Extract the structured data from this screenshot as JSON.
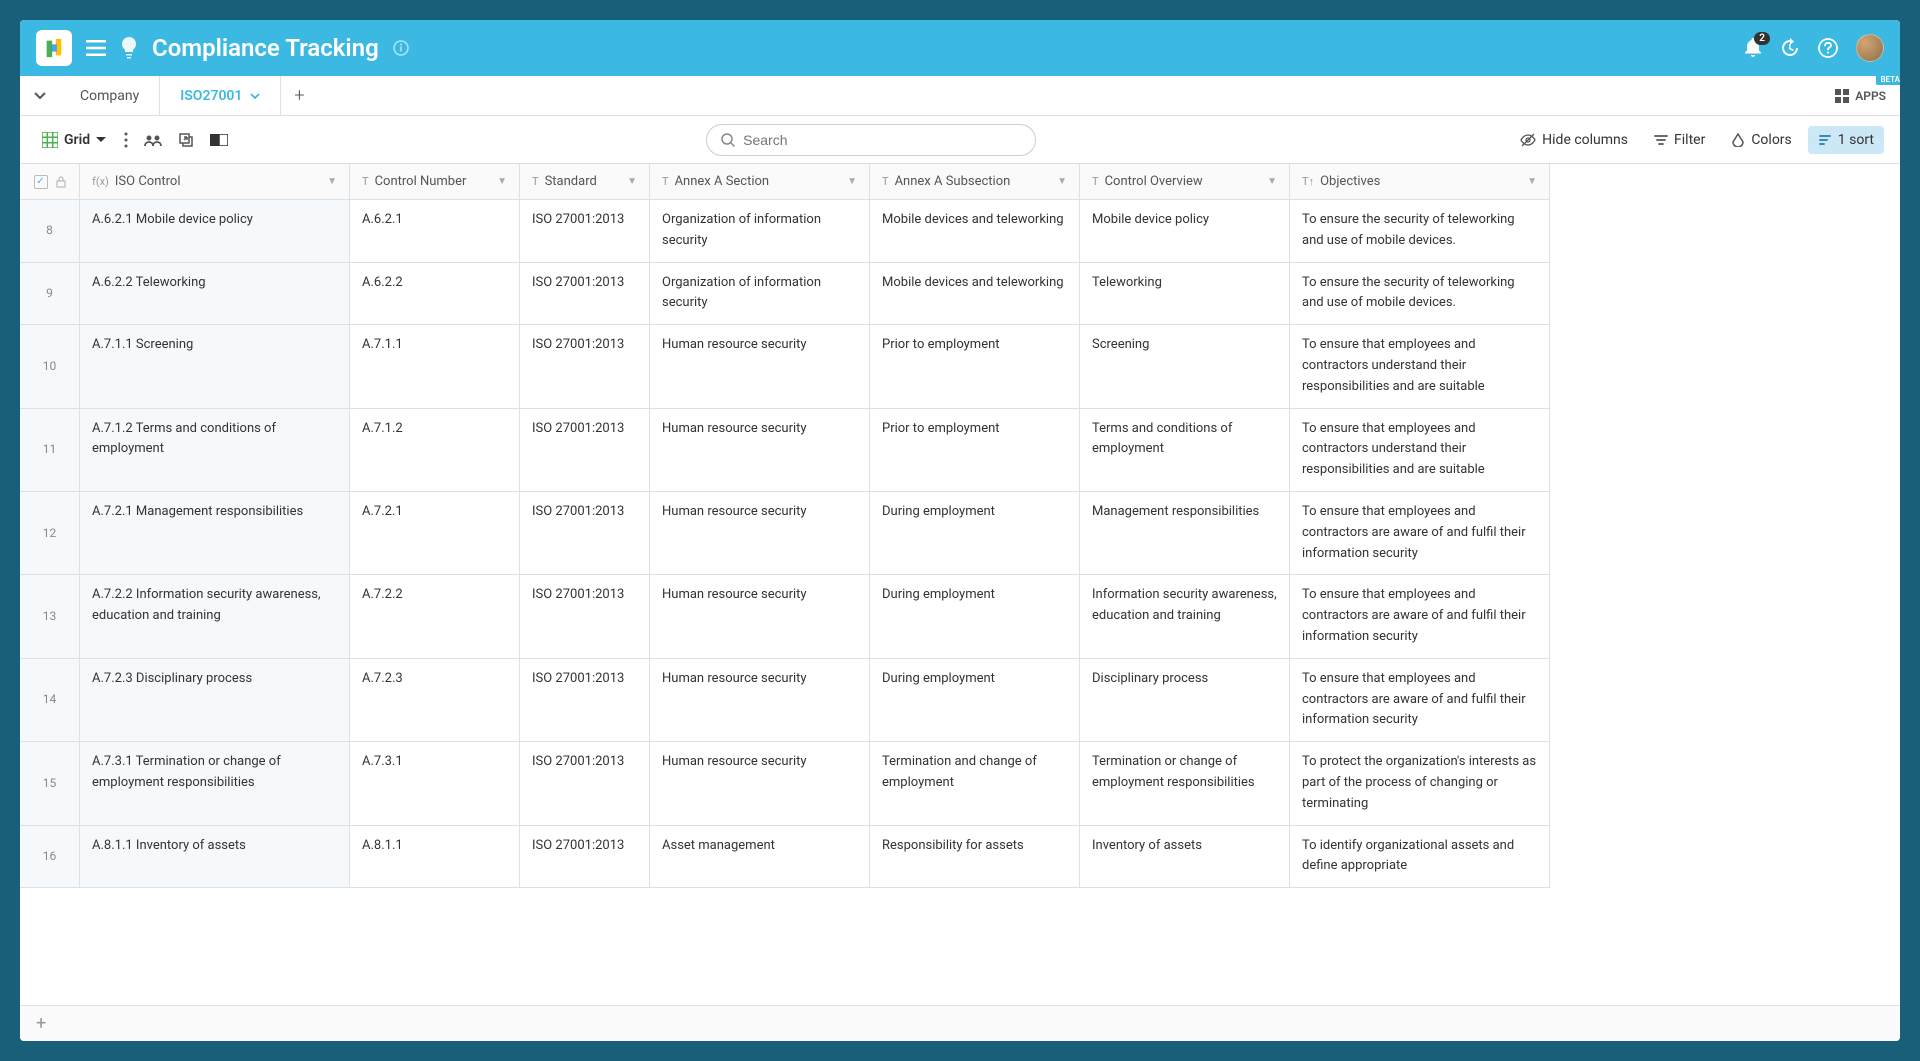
{
  "header": {
    "title": "Compliance Tracking",
    "notification_count": "2"
  },
  "tabs": {
    "items": [
      {
        "label": "Company",
        "active": false
      },
      {
        "label": "ISO27001",
        "active": true
      }
    ],
    "apps_label": "APPS",
    "beta_label": "BETA"
  },
  "toolbar": {
    "view_label": "Grid",
    "search_placeholder": "Search",
    "hide_columns": "Hide columns",
    "filter": "Filter",
    "colors": "Colors",
    "sort": "1 sort"
  },
  "columns": [
    {
      "label": "ISO Control",
      "type": "f(x)"
    },
    {
      "label": "Control Number",
      "type": "T"
    },
    {
      "label": "Standard",
      "type": "T"
    },
    {
      "label": "Annex A Section",
      "type": "T"
    },
    {
      "label": "Annex A Subsection",
      "type": "T"
    },
    {
      "label": "Control Overview",
      "type": "T"
    },
    {
      "label": "Objectives",
      "type": "T↑"
    }
  ],
  "rows": [
    {
      "n": "8",
      "iso": "A.6.2.1 Mobile device policy",
      "num": "A.6.2.1",
      "std": "ISO 27001:2013",
      "sec": "Organization of information security",
      "sub": "Mobile devices and teleworking",
      "ov": "Mobile device policy",
      "obj": "To ensure the security of teleworking and use of mobile devices."
    },
    {
      "n": "9",
      "iso": "A.6.2.2 Teleworking",
      "num": "A.6.2.2",
      "std": "ISO 27001:2013",
      "sec": "Organization of information security",
      "sub": "Mobile devices and teleworking",
      "ov": "Teleworking",
      "obj": "To ensure the security of teleworking and use of mobile devices."
    },
    {
      "n": "10",
      "iso": "A.7.1.1 Screening",
      "num": "A.7.1.1",
      "std": "ISO 27001:2013",
      "sec": "Human resource security",
      "sub": "Prior to employment",
      "ov": "Screening",
      "obj": "To ensure that employees and contractors understand their responsibilities and are suitable"
    },
    {
      "n": "11",
      "iso": "A.7.1.2 Terms and conditions of employment",
      "num": "A.7.1.2",
      "std": "ISO 27001:2013",
      "sec": "Human resource security",
      "sub": "Prior to employment",
      "ov": "Terms and conditions of employment",
      "obj": "To ensure that employees and contractors understand their responsibilities and are suitable"
    },
    {
      "n": "12",
      "iso": "A.7.2.1 Management responsibilities",
      "num": "A.7.2.1",
      "std": "ISO 27001:2013",
      "sec": "Human resource security",
      "sub": "During employment",
      "ov": "Management responsibilities",
      "obj": "To ensure that employees and contractors are aware of and fulfil their information security"
    },
    {
      "n": "13",
      "iso": "A.7.2.2 Information security awareness, education and training",
      "num": "A.7.2.2",
      "std": "ISO 27001:2013",
      "sec": "Human resource security",
      "sub": "During employment",
      "ov": "Information security awareness, education and training",
      "obj": "To ensure that employees and contractors are aware of and fulfil their information security"
    },
    {
      "n": "14",
      "iso": "A.7.2.3 Disciplinary process",
      "num": "A.7.2.3",
      "std": "ISO 27001:2013",
      "sec": "Human resource security",
      "sub": "During employment",
      "ov": "Disciplinary process",
      "obj": "To ensure that employees and contractors are aware of and fulfil their information security"
    },
    {
      "n": "15",
      "iso": "A.7.3.1 Termination or change of employment responsibilities",
      "num": "A.7.3.1",
      "std": "ISO 27001:2013",
      "sec": "Human resource security",
      "sub": "Termination and change of employment",
      "ov": "Termination or change of employment responsibilities",
      "obj": "To protect the organization's interests as part of the process of changing or terminating"
    },
    {
      "n": "16",
      "iso": "A.8.1.1 Inventory of assets",
      "num": "A.8.1.1",
      "std": "ISO 27001:2013",
      "sec": "Asset management",
      "sub": "Responsibility for assets",
      "ov": "Inventory of assets",
      "obj": "To identify organizational assets and define appropriate"
    }
  ]
}
